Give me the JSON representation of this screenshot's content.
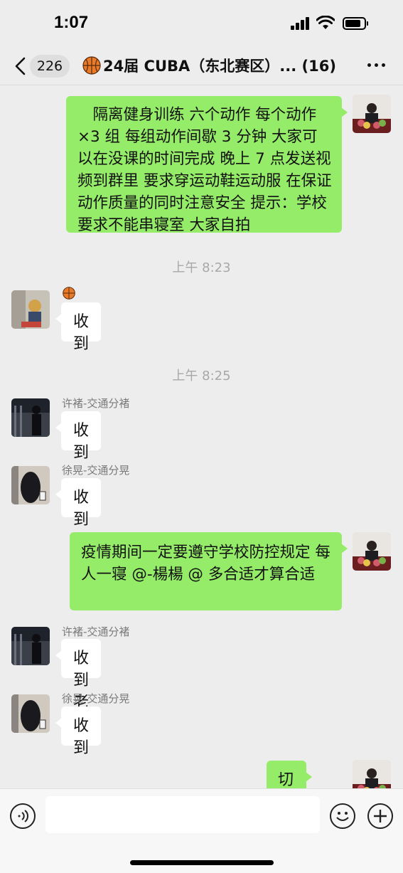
{
  "status_bar": {
    "time": "1:07"
  },
  "nav": {
    "back_count": "226",
    "title": "24届 CUBA（东北赛区）...",
    "member_count": "(16)",
    "title_icon": "basketball-icon",
    "more_icon": "more-dots-icon"
  },
  "messages": [
    {
      "type": "out",
      "text": "　隔离健身训练 六个动作 每个动作×3 组 每组动作间歇 3 分钟 大家可以在没课的时间完成 晚上 7 点发送视频到群里 要求穿运动鞋运动服 在保证动作质量的同时注意安全 提示：学校要求不能串寝室 大家自拍"
    },
    {
      "type": "time",
      "text": "上午 8:23"
    },
    {
      "type": "in",
      "sender_icon": "basketball-icon",
      "text": "收到"
    },
    {
      "type": "time",
      "text": "上午 8:25"
    },
    {
      "type": "in",
      "sender": "许褚-交通分褚",
      "text": "收到"
    },
    {
      "type": "in",
      "sender": "徐晃-交通分晃",
      "text": "收到"
    },
    {
      "type": "out",
      "text": "疫情期间一定要遵守学校防控规定 每人一寝 @-楊楊 @ 多合适才算合适"
    },
    {
      "type": "in",
      "sender": "许褚-交通分褚",
      "text": "收到老师"
    },
    {
      "type": "in",
      "sender": "徐晃-交通分晃",
      "text": "收到"
    },
    {
      "type": "out",
      "text": "切记",
      "emoji_icon": "bomb-icon"
    }
  ],
  "input_bar": {
    "voice_icon": "voice-icon",
    "emoji_icon": "smiley-icon",
    "plus_icon": "plus-icon",
    "placeholder": ""
  },
  "colors": {
    "background": "#ededed",
    "outgoing_bubble": "#95ec69",
    "incoming_bubble": "#ffffff",
    "timestamp": "#a8a8a8"
  }
}
